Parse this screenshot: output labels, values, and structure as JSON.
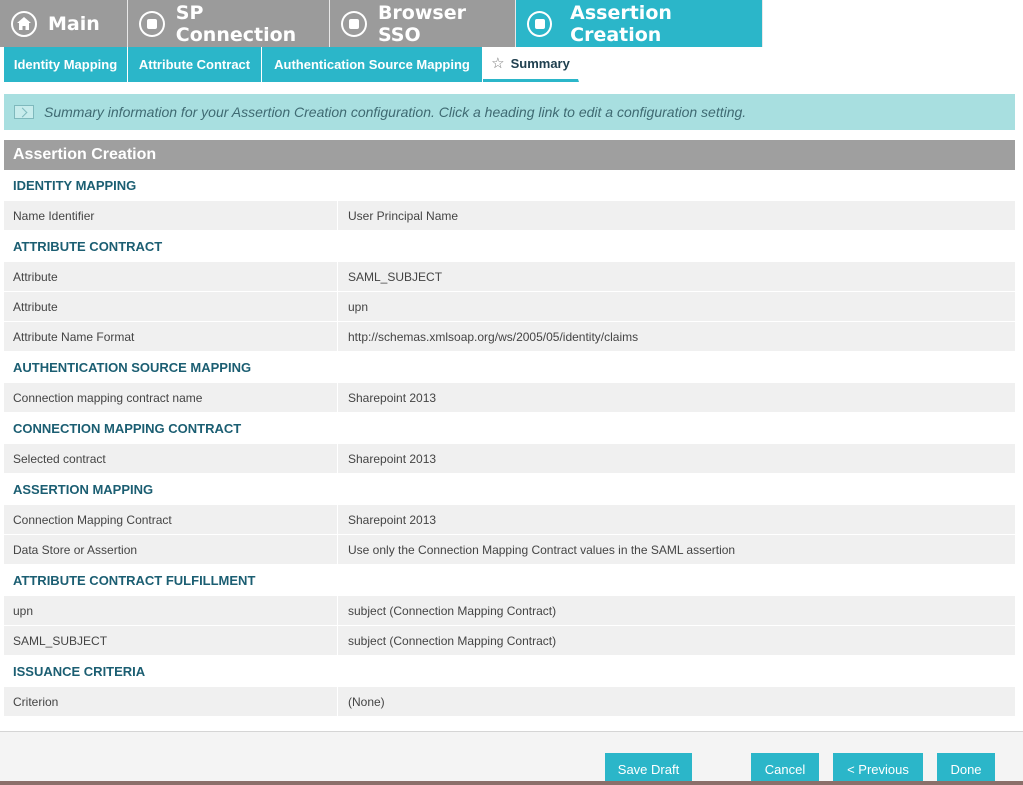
{
  "top_tabs": [
    {
      "label": "Main",
      "icon": "home-icon"
    },
    {
      "label": "SP Connection",
      "icon": "circle-square-icon"
    },
    {
      "label": "Browser SSO",
      "icon": "circle-square-icon"
    },
    {
      "label": "Assertion Creation",
      "icon": "circle-square-icon",
      "active": true
    }
  ],
  "sub_tabs": [
    {
      "label": "Identity Mapping"
    },
    {
      "label": "Attribute Contract"
    },
    {
      "label": "Authentication Source Mapping"
    },
    {
      "label": "Summary",
      "active": true,
      "icon": "star-icon"
    }
  ],
  "banner": {
    "text": "Summary information for your Assertion Creation configuration. Click a heading link to edit a configuration setting."
  },
  "summary": {
    "title": "Assertion Creation",
    "sections": [
      {
        "heading": "IDENTITY MAPPING",
        "rows": [
          {
            "key": "Name Identifier",
            "value": "User Principal Name"
          }
        ]
      },
      {
        "heading": "ATTRIBUTE CONTRACT",
        "rows": [
          {
            "key": "Attribute",
            "value": "SAML_SUBJECT"
          },
          {
            "key": "Attribute",
            "value": "upn"
          },
          {
            "key": "Attribute Name Format",
            "value": "http://schemas.xmlsoap.org/ws/2005/05/identity/claims"
          }
        ]
      },
      {
        "heading": "AUTHENTICATION SOURCE MAPPING",
        "rows": [
          {
            "key": "Connection mapping contract name",
            "value": "Sharepoint 2013"
          }
        ]
      },
      {
        "heading": "CONNECTION MAPPING CONTRACT",
        "rows": [
          {
            "key": "Selected contract",
            "value": "Sharepoint 2013"
          }
        ]
      },
      {
        "heading": "ASSERTION MAPPING",
        "rows": [
          {
            "key": "Connection Mapping Contract",
            "value": "Sharepoint 2013"
          },
          {
            "key": "Data Store or Assertion",
            "value": "Use only the Connection Mapping Contract values in the SAML assertion"
          }
        ]
      },
      {
        "heading": "ATTRIBUTE CONTRACT FULFILLMENT",
        "rows": [
          {
            "key": "upn",
            "value": "subject (Connection Mapping Contract)"
          },
          {
            "key": "SAML_SUBJECT",
            "value": "subject (Connection Mapping Contract)"
          }
        ]
      },
      {
        "heading": "ISSUANCE CRITERIA",
        "rows": [
          {
            "key": "Criterion",
            "value": "(None)"
          }
        ]
      }
    ]
  },
  "footer": {
    "save_draft": "Save Draft",
    "cancel": "Cancel",
    "previous": "< Previous",
    "done": "Done"
  },
  "colors": {
    "accent": "#2bb6c9",
    "inactive_tab": "#9b9b9b",
    "banner_bg": "#a8dfe0",
    "section_heading": "#1b5e72"
  }
}
